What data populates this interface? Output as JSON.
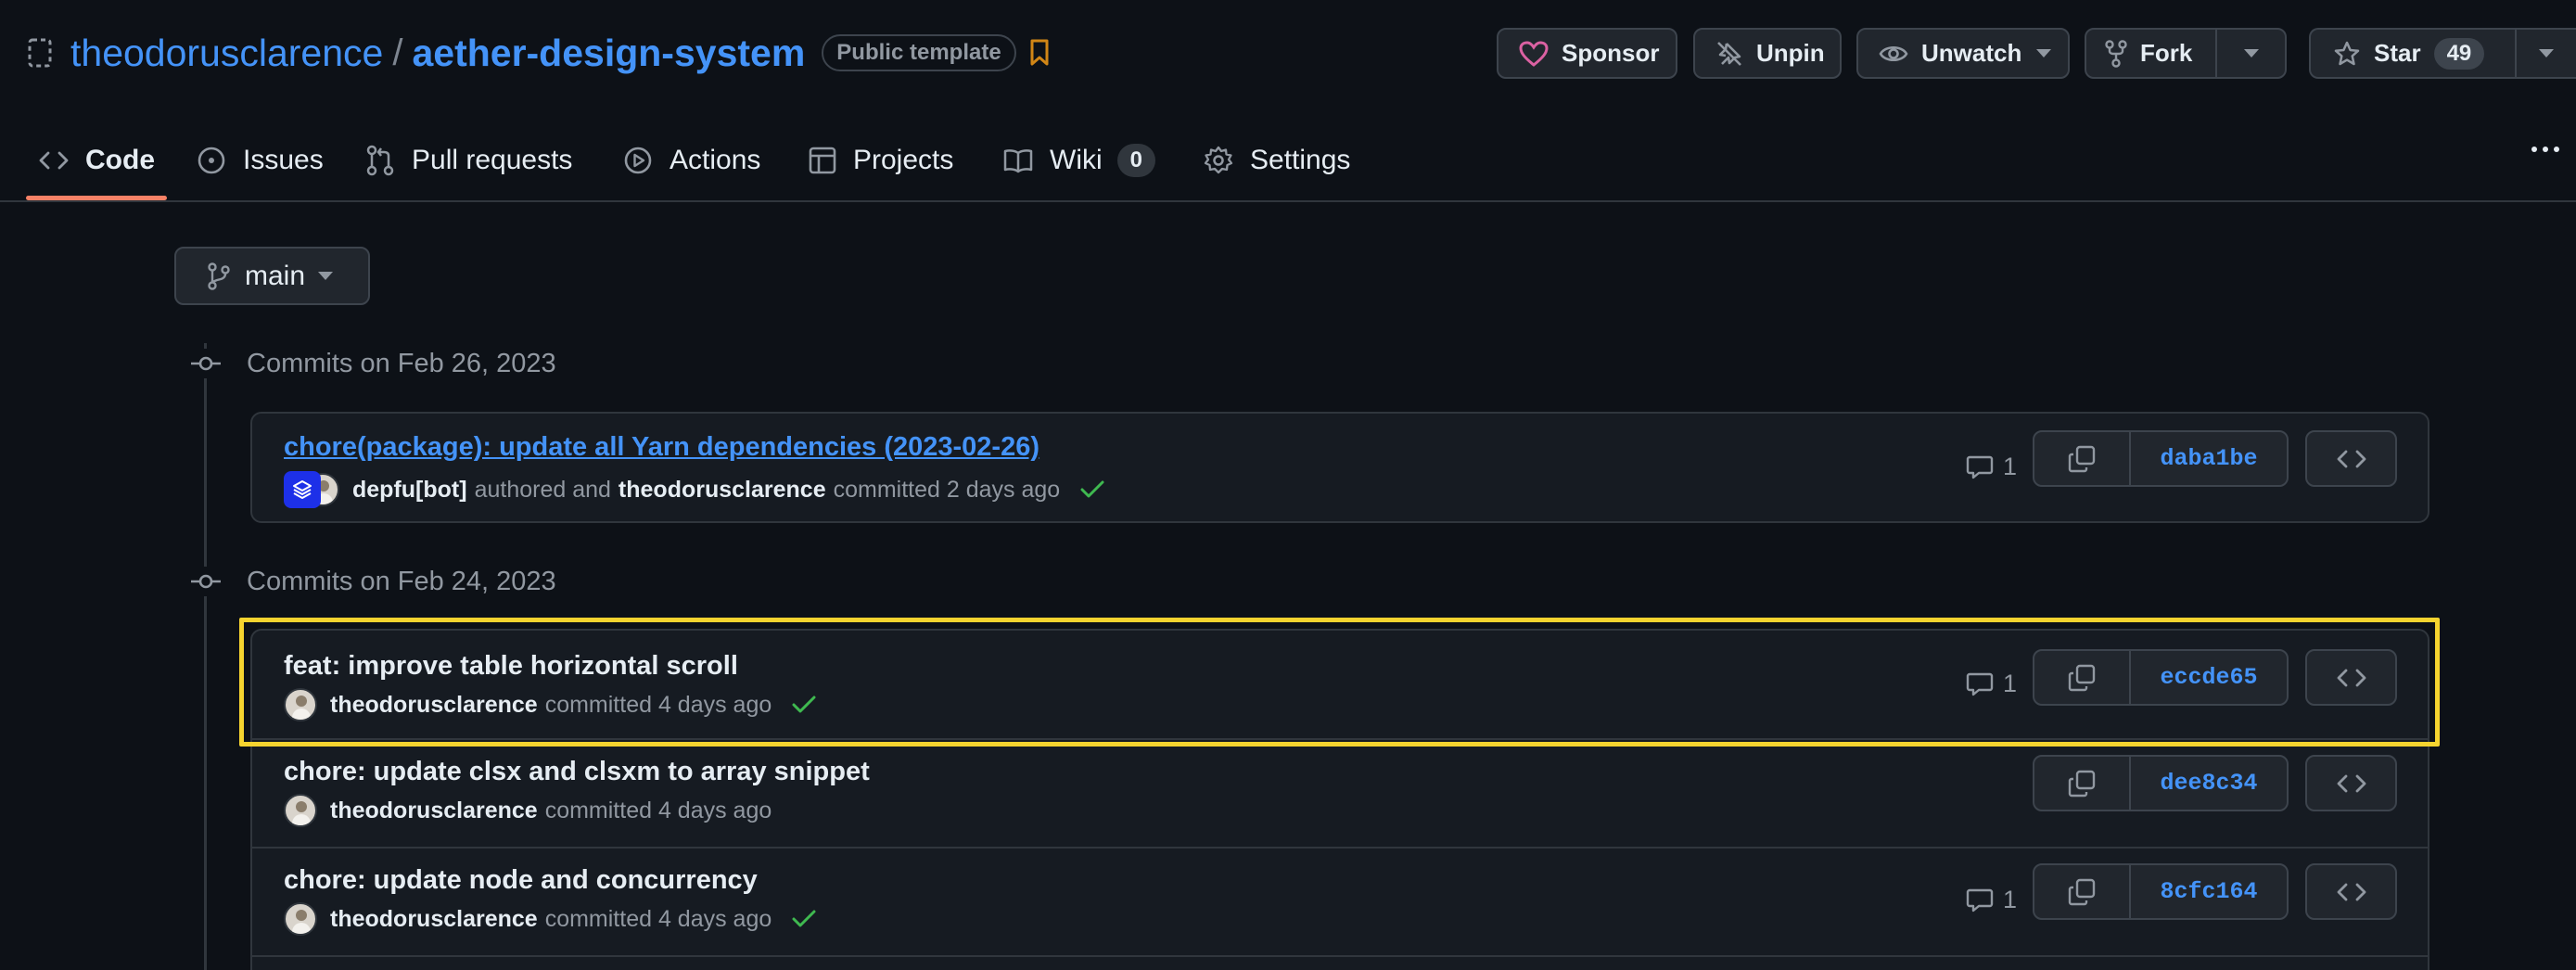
{
  "repo": {
    "owner": "theodorusclarence",
    "separator": "/",
    "name": "aether-design-system",
    "visibility_badge": "Public template"
  },
  "header_buttons": {
    "sponsor": "Sponsor",
    "unpin": "Unpin",
    "unwatch": "Unwatch",
    "fork": "Fork",
    "star": "Star",
    "star_count": "49"
  },
  "tabs": {
    "code": "Code",
    "issues": "Issues",
    "pull_requests": "Pull requests",
    "actions": "Actions",
    "projects": "Projects",
    "wiki": "Wiki",
    "wiki_count": "0",
    "settings": "Settings"
  },
  "branch": {
    "name": "main"
  },
  "groups": [
    {
      "heading": "Commits on Feb 26, 2023",
      "commits": [
        {
          "title": "chore(package): update all Yarn dependencies (2023-02-26)",
          "author": "depfu[bot]",
          "authored_text": "authored and",
          "committer": "theodorusclarence",
          "committed_text": "committed 2 days ago",
          "comments": "1",
          "sha": "daba1be",
          "status": "success"
        }
      ]
    },
    {
      "heading": "Commits on Feb 24, 2023",
      "commits": [
        {
          "title": "feat: improve table horizontal scroll",
          "committer": "theodorusclarence",
          "committed_text": "committed 4 days ago",
          "comments": "1",
          "sha": "eccde65",
          "status": "success"
        },
        {
          "title": "chore: update clsx and clsxm to array snippet",
          "committer": "theodorusclarence",
          "committed_text": "committed 4 days ago",
          "sha": "dee8c34"
        },
        {
          "title": "chore: update node and concurrency",
          "committer": "theodorusclarence",
          "committed_text": "committed 4 days ago",
          "comments": "1",
          "sha": "8cfc164",
          "status": "success"
        }
      ]
    }
  ],
  "colors": {
    "background": "#0d1117",
    "link": "#4493f8",
    "tab_underline": "#f78166",
    "success": "#3fb950",
    "highlight": "#f6d42f",
    "sponsor_heart": "#db61a2",
    "bookmark": "#d18616"
  }
}
